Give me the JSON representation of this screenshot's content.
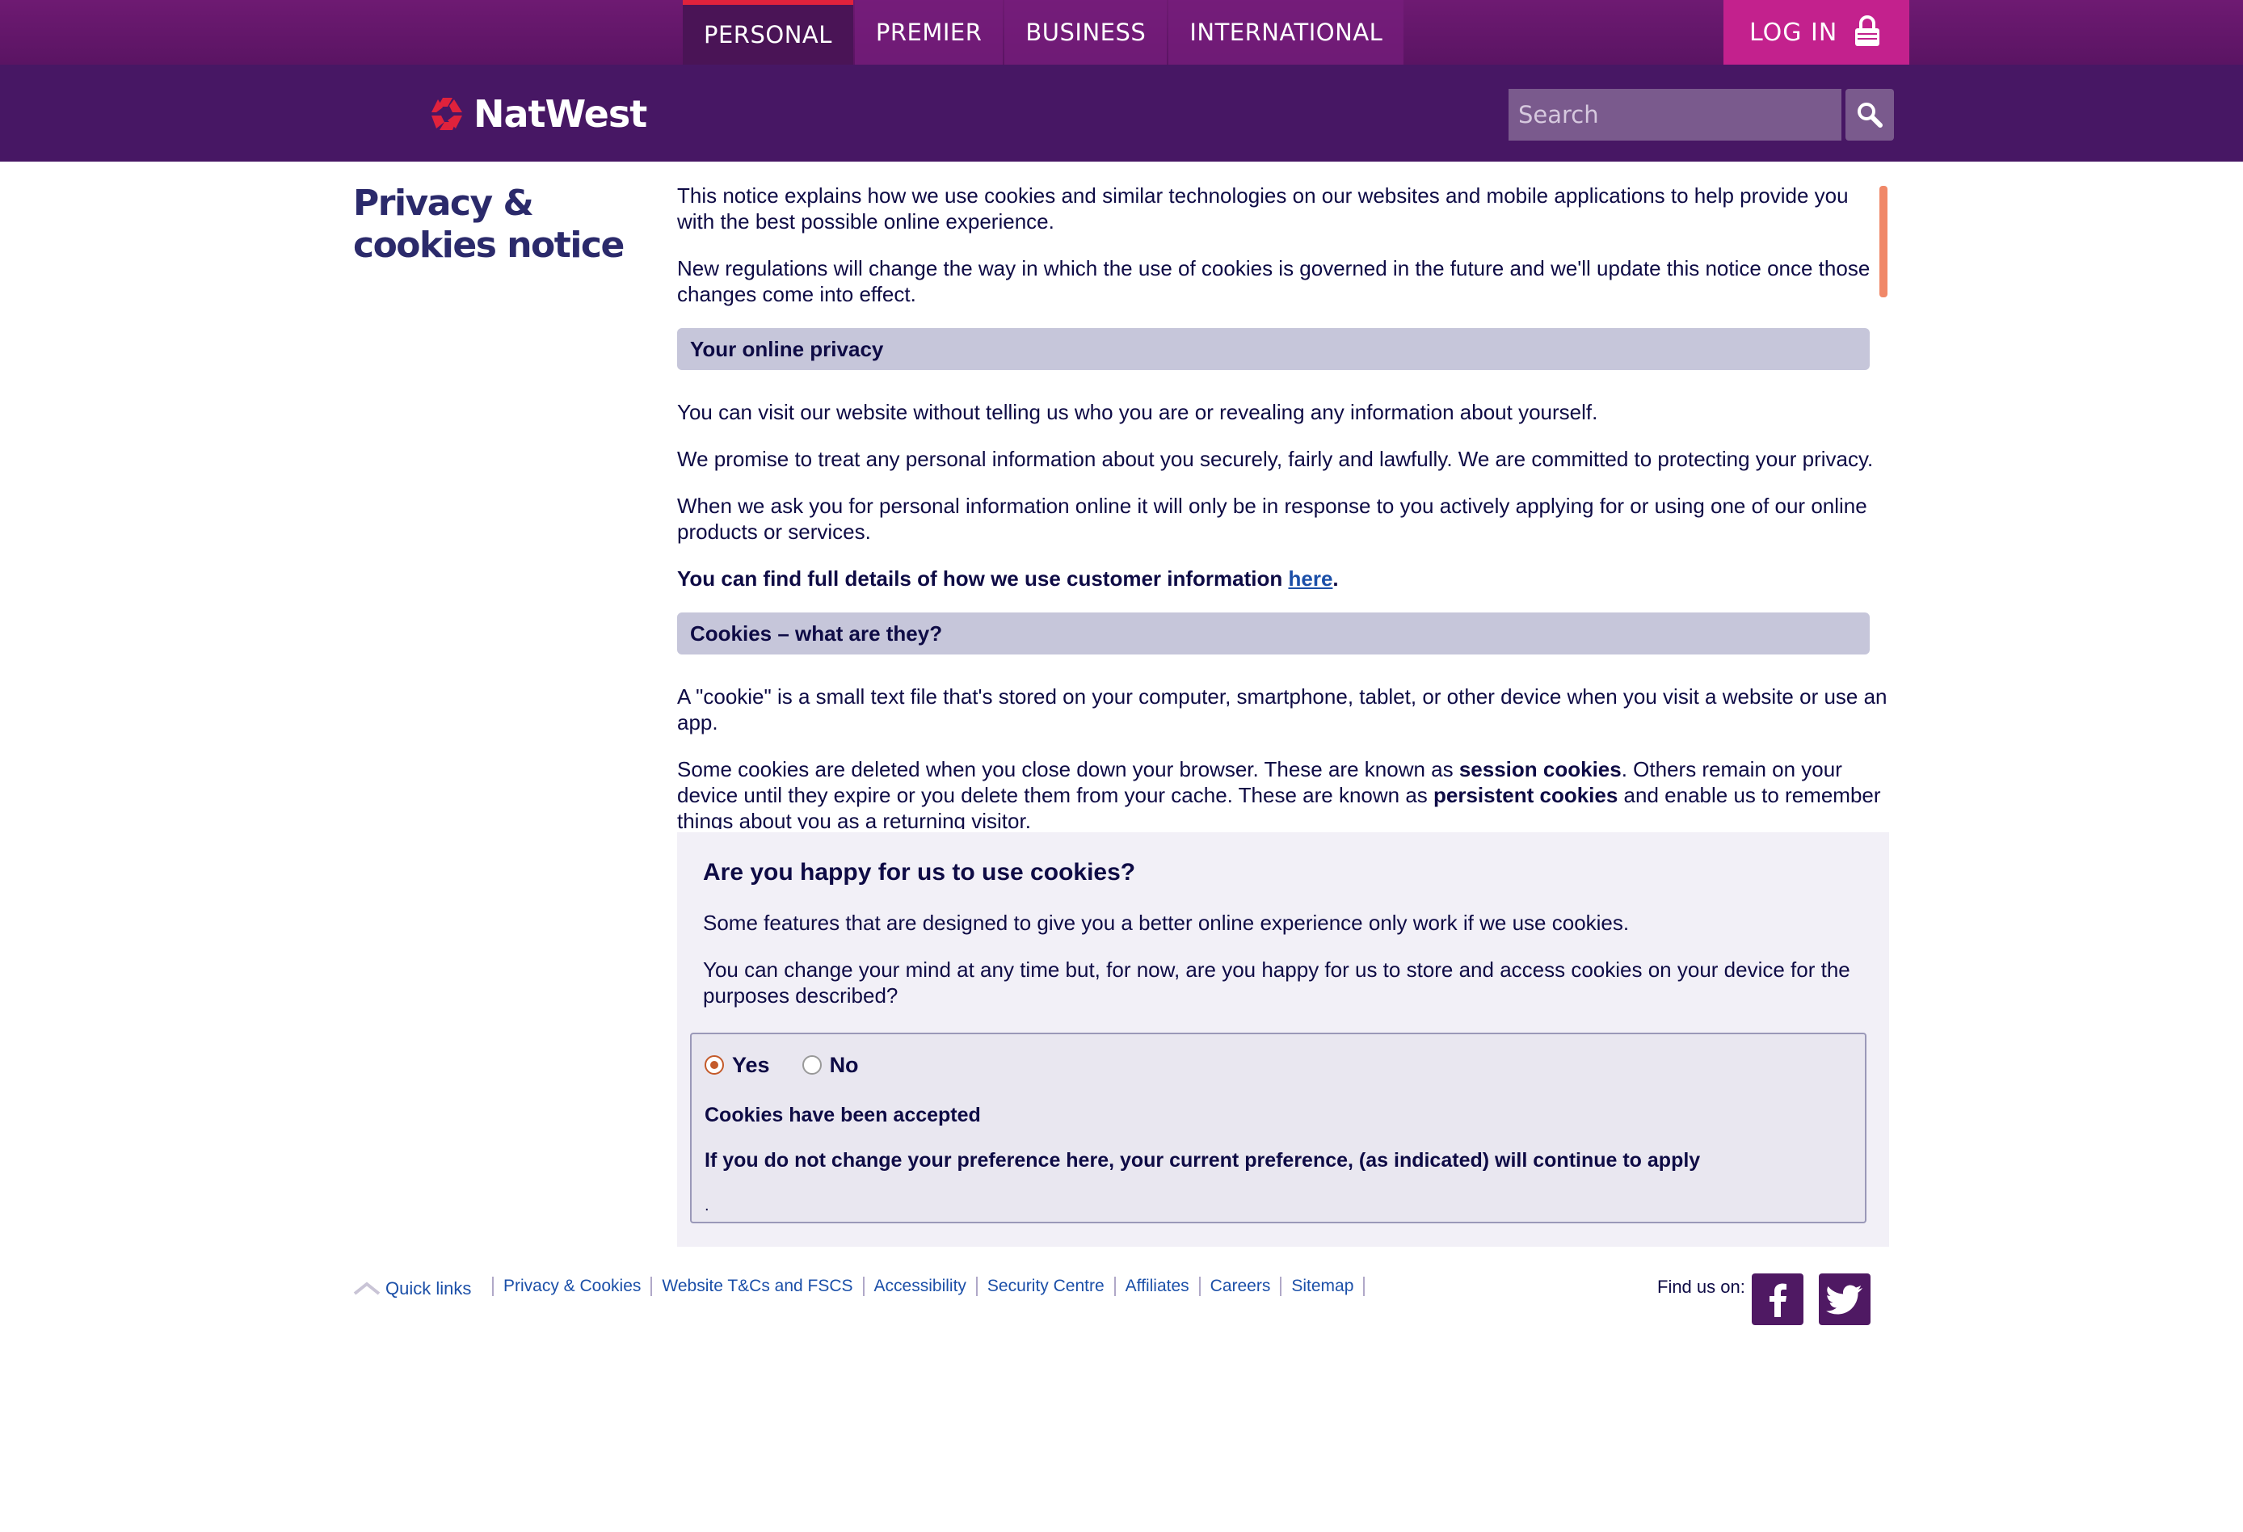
{
  "nav": {
    "tabs": [
      {
        "label": "PERSONAL"
      },
      {
        "label": "PREMIER"
      },
      {
        "label": "BUSINESS"
      },
      {
        "label": "INTERNATIONAL"
      }
    ],
    "login_label": "LOG IN"
  },
  "header": {
    "brand": "NatWest",
    "search_placeholder": "Search"
  },
  "page": {
    "title": "Privacy & cookies notice"
  },
  "content": {
    "intro": [
      "This notice explains how we use cookies and similar technologies on our websites and mobile applications to help provide you with the best possible online experience.",
      "New regulations will change the way in which the use of cookies is governed in the future and we'll update this notice once those changes come into effect."
    ],
    "privacy_heading": "Your online privacy",
    "privacy_paragraphs": [
      "You can visit our website without telling us who you are or revealing any information about yourself.",
      "We promise to treat any personal information about you securely, fairly and lawfully. We are committed to protecting your privacy.",
      "When we ask you for personal information online it will only be in response to you actively applying for or using one of our online products or services."
    ],
    "details_text": "You can find full details of how we use customer information ",
    "details_link": "here",
    "details_end": ".",
    "cookies_heading": "Cookies – what are they?",
    "cookie_def": "A \"cookie\" is a small text file that's stored on your computer, smartphone, tablet, or other device when you visit a website or use an app.",
    "session_pre": "Some cookies are deleted when you close down your browser. These are known as ",
    "session_bold": "session cookies",
    "session_mid": ". Others remain on your device until they expire or you delete them from your cache. These are known as ",
    "persistent_bold": "persistent cookies",
    "session_post": " and enable us to remember things about you as a returning visitor."
  },
  "consent": {
    "heading": "Are you happy for us to use cookies?",
    "para1": "Some features that are designed to give you a better online experience only work if we use cookies.",
    "para2": "You can change your mind at any time but, for now, are you happy for us to store and access cookies on your device for the purposes described?",
    "yes_label": "Yes",
    "no_label": "No",
    "selected": "Yes",
    "status": "Cookies have been accepted",
    "note": "If you do not change your preference here, your current preference, (as indicated) will continue to apply",
    "dot": "."
  },
  "footer": {
    "quick_links_label": "Quick links",
    "links": [
      "Privacy & Cookies",
      "Website T&Cs and FSCS",
      "Accessibility",
      "Security Centre",
      "Affiliates",
      "Careers",
      "Sitemap"
    ],
    "find_us_label": "Find us on:"
  },
  "icons": {
    "logo": "natwest-logo-icon",
    "lock": "lock-icon",
    "search": "search-icon",
    "facebook": "facebook-icon",
    "twitter": "twitter-icon",
    "quick_links": "chevron-up-icon"
  },
  "colors": {
    "brand_purple": "#471764",
    "login_magenta": "#c3218d",
    "active_tab_accent": "#e0223c",
    "logo_red": "#e0223c",
    "link_blue": "#1b4fa8"
  }
}
